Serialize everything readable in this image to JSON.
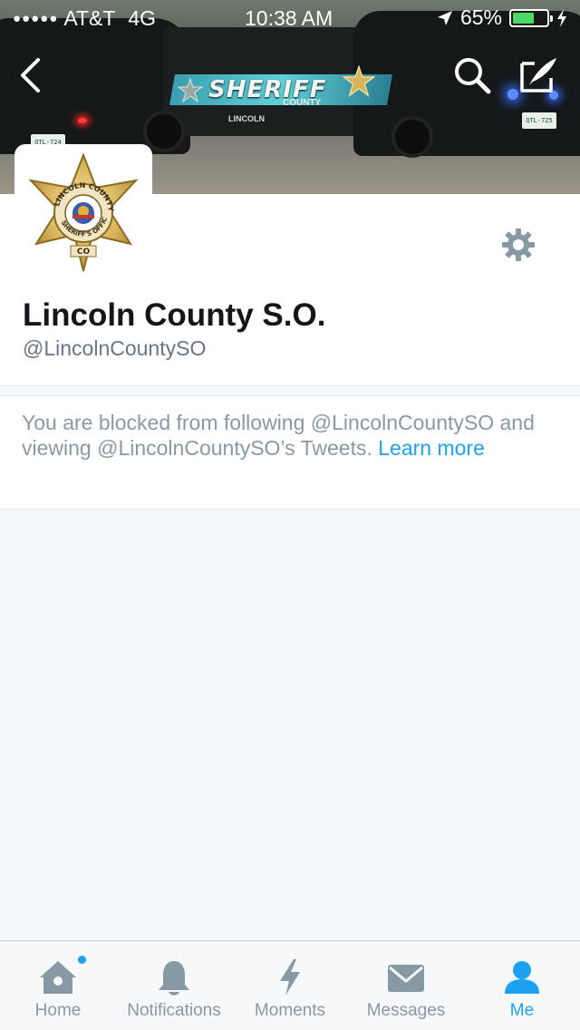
{
  "status_bar": {
    "signal_dots": "●●●●●",
    "carrier": "AT&T",
    "network": "4G",
    "time": "10:38 AM",
    "battery_percent": "65%",
    "battery_level": 0.65,
    "battery_color": "#4cd964"
  },
  "header": {
    "back_icon": "back-chevron-icon",
    "search_icon": "search-icon",
    "compose_icon": "compose-icon",
    "banner_text": {
      "sheriff": "SHERIFF",
      "county": "COUNTY",
      "lincoln": "LINCOLN",
      "plate_left": "QTL-724",
      "plate_right": "QTL-725"
    }
  },
  "profile": {
    "name": "Lincoln County S.O.",
    "handle": "@LincolnCountySO",
    "avatar_badge_lines": [
      "LINCOLN COUNTY",
      "STATE OF COLORADO",
      "SHERIFF'S OFFICE",
      "CO"
    ],
    "settings_icon": "gear-icon"
  },
  "notice": {
    "text": "You are blocked from following @LincolnCountySO and viewing @LincolnCountySO’s Tweets. ",
    "link": "Learn more"
  },
  "tabs": [
    {
      "label": "Home",
      "icon": "home-icon",
      "active": false,
      "has_dot": true
    },
    {
      "label": "Notifications",
      "icon": "bell-icon",
      "active": false
    },
    {
      "label": "Moments",
      "icon": "lightning-icon",
      "active": false
    },
    {
      "label": "Messages",
      "icon": "envelope-icon",
      "active": false
    },
    {
      "label": "Me",
      "icon": "person-icon",
      "active": true
    }
  ],
  "colors": {
    "accent": "#1da1f2",
    "muted": "#8899a6",
    "text": "#14171a",
    "background": "#f5f8fa"
  }
}
